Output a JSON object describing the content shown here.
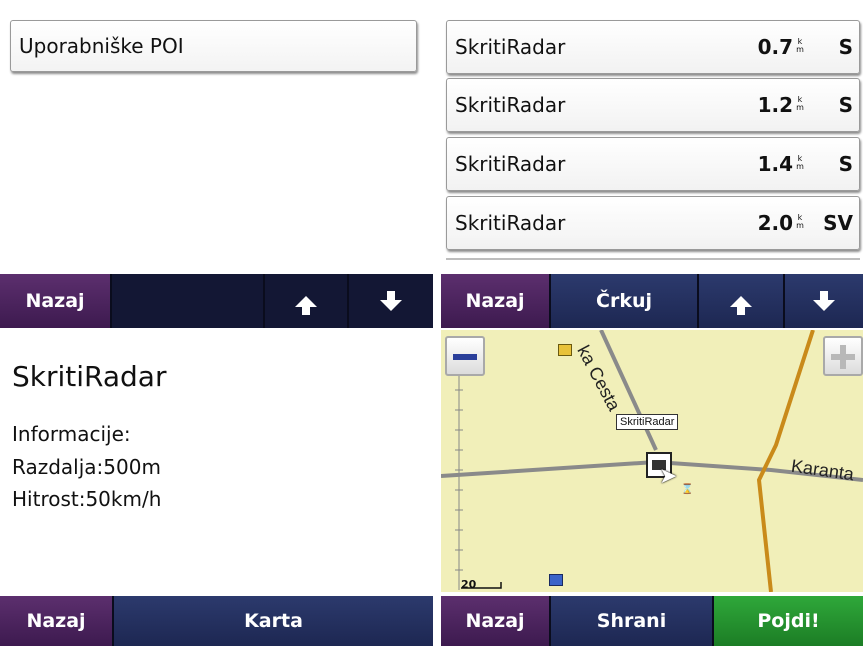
{
  "top_left": {
    "item": "Uporabniške POI",
    "bar": {
      "back": "Nazaj"
    }
  },
  "top_right": {
    "rows": [
      {
        "name": "SkritiRadar",
        "distance": "0.7",
        "unit_top": "k",
        "unit_bottom": "m",
        "dir": "S"
      },
      {
        "name": "SkritiRadar",
        "distance": "1.2",
        "unit_top": "k",
        "unit_bottom": "m",
        "dir": "S"
      },
      {
        "name": "SkritiRadar",
        "distance": "1.4",
        "unit_top": "k",
        "unit_bottom": "m",
        "dir": "S"
      },
      {
        "name": "SkritiRadar",
        "distance": "2.0",
        "unit_top": "k",
        "unit_bottom": "m",
        "dir": "SV"
      }
    ],
    "bar": {
      "back": "Nazaj",
      "spell": "Črkuj"
    }
  },
  "bottom_left": {
    "title": "SkritiRadar",
    "info_heading": "Informacije:",
    "distance": "Razdalja:500m",
    "speed": "Hitrost:50km/h",
    "bar": {
      "back": "Nazaj",
      "map": "Karta"
    }
  },
  "bottom_right": {
    "map": {
      "road_1": "ka Cesta",
      "road_2": "Karanta",
      "poi_label": "SkritiRadar",
      "scale": "20",
      "zoom_out_icon": "minus-icon",
      "zoom_in_icon": "plus-icon",
      "road_colors": {
        "minor": "#8a8a8a",
        "major": "#c98a1a"
      },
      "map_background": "#f1efb9"
    },
    "bar": {
      "back": "Nazaj",
      "save": "Shrani",
      "go": "Pojdi!"
    }
  },
  "colors": {
    "back_button": "#4a2260",
    "nav_button": "#24305f",
    "go_button": "#24962f"
  }
}
